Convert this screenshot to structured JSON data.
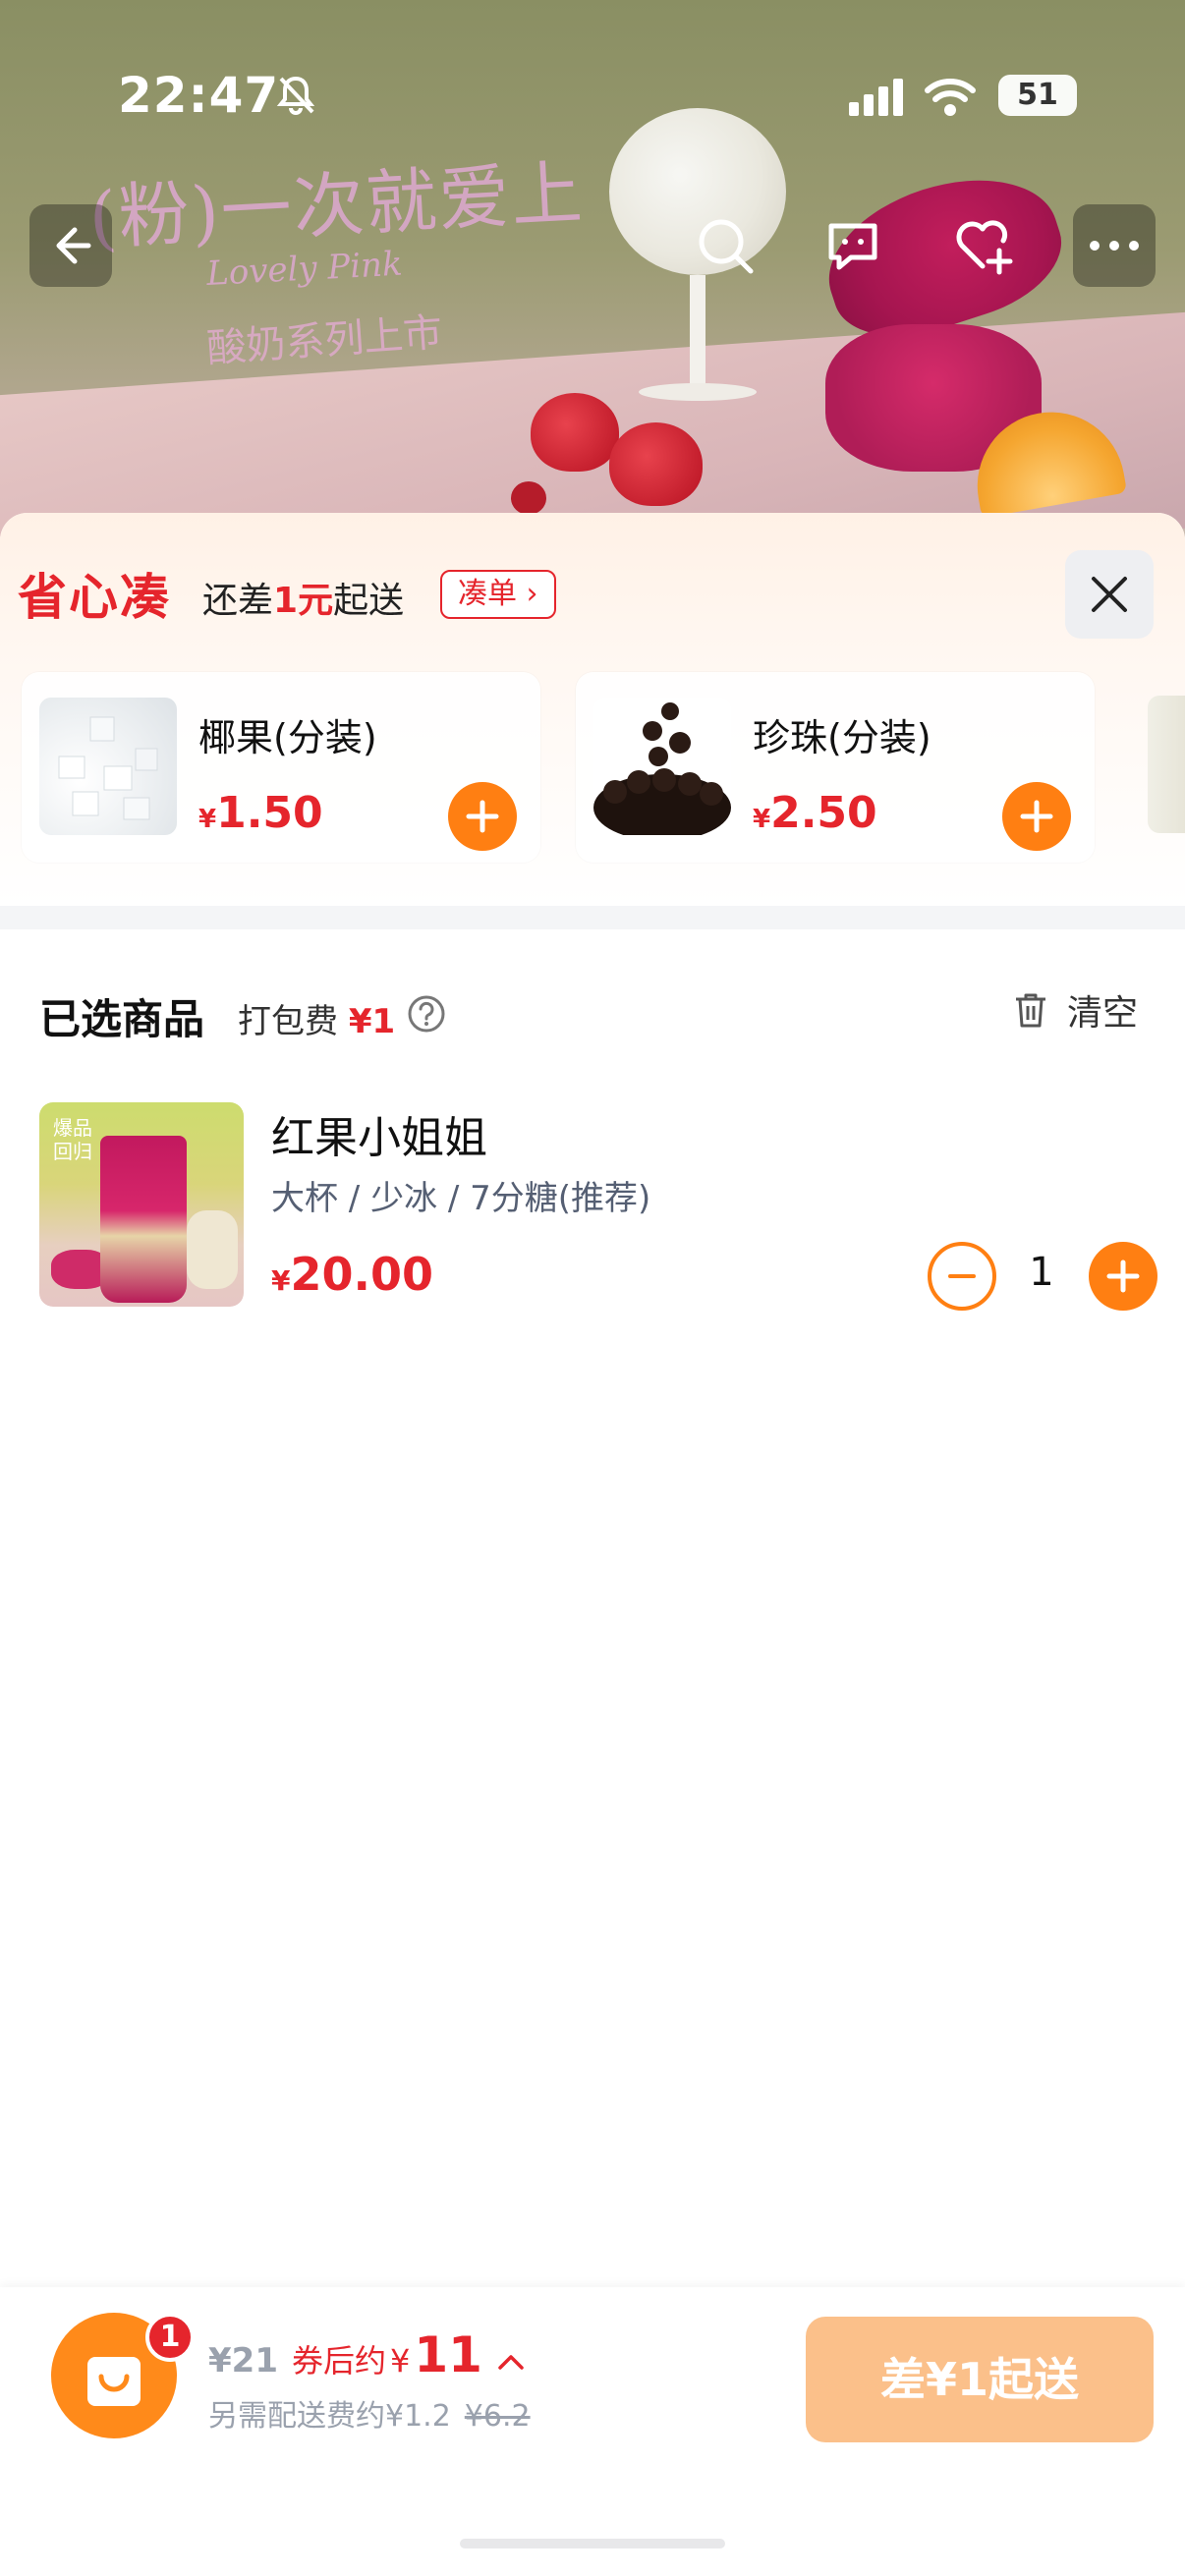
{
  "status": {
    "time": "22:47",
    "battery": "51"
  },
  "banner": {
    "slogan_line1": "(粉)一次就爱上",
    "slogan_line2": "Lovely Pink",
    "slogan_line3": "酸奶系列上市"
  },
  "icons": {
    "back": "arrow-left-icon",
    "search": "search-icon",
    "chat": "message-icon",
    "favorite": "heart-plus-icon",
    "more": "more-icon",
    "close": "close-icon",
    "add": "plus-icon",
    "remove": "minus-icon",
    "trash": "trash-icon",
    "help": "question-icon",
    "cart": "shopping-bag-icon"
  },
  "promo": {
    "brand": "省心凑",
    "need_prefix": "还差",
    "need_amount": "1元",
    "need_suffix": "起送",
    "cou_button": "凑单 ›",
    "addons": [
      {
        "name": "椰果(分装)",
        "currency": "¥",
        "price": "1.50"
      },
      {
        "name": "珍珠(分装)",
        "currency": "¥",
        "price": "2.50"
      }
    ]
  },
  "selected": {
    "title": "已选商品",
    "pack_label": "打包费",
    "pack_fee": "¥1",
    "clear_label": "清空",
    "items": [
      {
        "tag": "爆品\n回归",
        "name": "红果小姐姐",
        "spec": "大杯 / 少冰 / 7分糖(推荐)",
        "currency": "¥",
        "price": "20.00",
        "qty": "1"
      }
    ]
  },
  "checkout": {
    "badge": "1",
    "orig_price": "¥21",
    "after_label": "券后约",
    "after_currency": "¥",
    "after_price": "11",
    "delivery_fee": "另需配送费约¥1.2",
    "delivery_fee_strike": "¥6.2",
    "submit_label": "差¥1起送"
  },
  "colors": {
    "accent": "#ff7f12",
    "price": "#e5252c",
    "submit_disabled": "#fbc08a"
  }
}
